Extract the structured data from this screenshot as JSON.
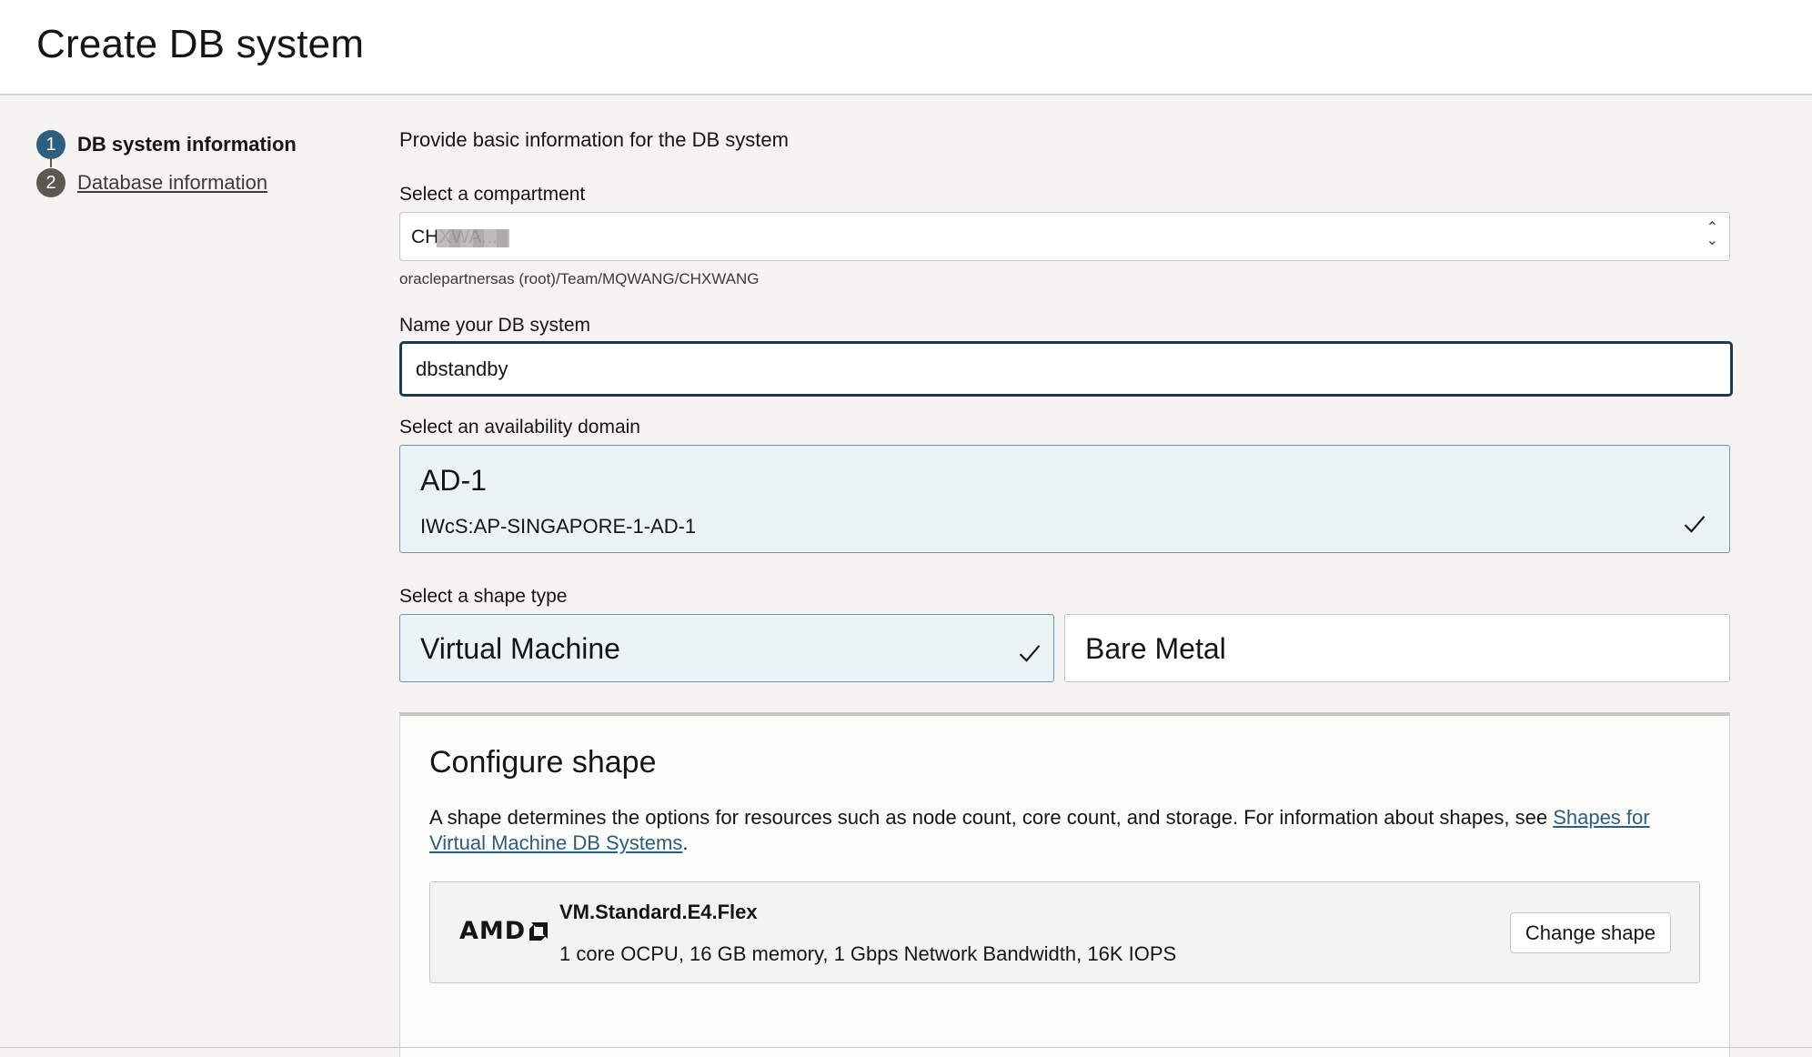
{
  "page": {
    "title": "Create DB system"
  },
  "steps": [
    {
      "number": "1",
      "label": "DB system information"
    },
    {
      "number": "2",
      "label": "Database information"
    }
  ],
  "form": {
    "intro": "Provide basic information for the DB system",
    "compartment": {
      "label": "Select a compartment",
      "value": "CHXWA...",
      "path": "oraclepartnersas (root)/Team/MQWANG/CHXWANG"
    },
    "name": {
      "label": "Name your DB system",
      "value": "dbstandby"
    },
    "availability_domain": {
      "label": "Select an availability domain",
      "title": "AD-1",
      "subtitle": "IWcS:AP-SINGAPORE-1-AD-1"
    },
    "shape_type": {
      "label": "Select a shape type",
      "options": [
        "Virtual Machine",
        "Bare Metal"
      ],
      "selected": "Virtual Machine"
    }
  },
  "configure_shape": {
    "title": "Configure shape",
    "desc_text": "A shape determines the options for resources such as node count, core count, and storage. For information about shapes, see ",
    "desc_link": "Shapes for Virtual Machine DB Systems",
    "desc_end": ".",
    "vendor": "AMD",
    "shape_name": "VM.Standard.E4.Flex",
    "shape_specs": "1 core OCPU, 16 GB memory, 1 Gbps Network Bandwidth, 16K IOPS",
    "change_button": "Change shape"
  },
  "icons": {
    "selected": "check-icon",
    "select": "chevron-up-down-icon",
    "vendor": "amd-logo-arrow-icon"
  },
  "colors": {
    "accent": "#2c5e7d",
    "selected_bg": "#ebf3f6",
    "selected_border": "#6b98b4"
  }
}
